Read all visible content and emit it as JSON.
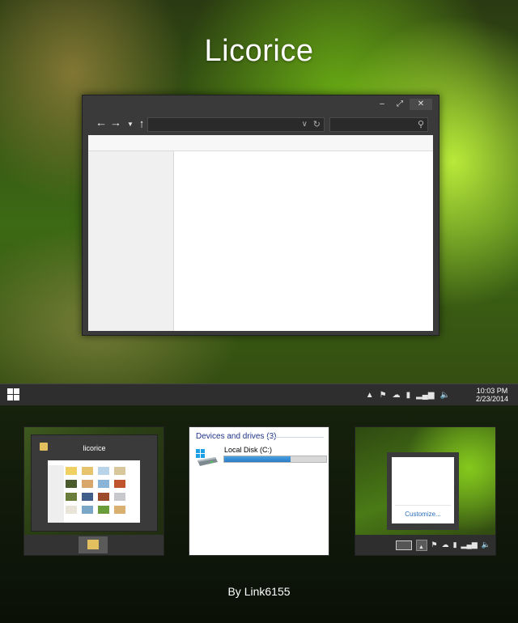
{
  "title": "Licorice",
  "credit": "By Link6155",
  "window": {
    "caption": {
      "minimize_icon": "minimize-icon",
      "maximize_icon": "maximize-icon",
      "close_icon": "close-icon"
    },
    "nav": {
      "back_icon": "back-arrow-icon",
      "forward_icon": "forward-arrow-icon",
      "recent_icon": "dropdown-icon",
      "up_icon": "up-arrow-icon"
    },
    "address_value": "",
    "search_value": ""
  },
  "taskbar": {
    "start_icon": "windows-logo-icon",
    "tray_icons": [
      "chevron-up-icon",
      "flag-icon",
      "cloud-icon",
      "battery-icon",
      "signal-icon",
      "volume-icon"
    ],
    "time": "10:03 PM",
    "date": "2/23/2014"
  },
  "thumbnails": {
    "explorer": {
      "title": "licorice",
      "colors": [
        "#f0d060",
        "#e7c36e",
        "#b9d4e8",
        "#d8c79a",
        "#4a5a2a",
        "#d9a66b",
        "#8ab3d8",
        "#c0542f",
        "#6a7d3b",
        "#3f5e8a",
        "#9c4c2c",
        "#c7c9cc",
        "#e8e4d8",
        "#7ba7c7",
        "#6a9c3a",
        "#d9b070"
      ]
    },
    "devices": {
      "heading": "Devices and drives (3)",
      "drive_label": "Local Disk (C:)",
      "drive_used_fraction": 0.65
    },
    "tray_popup": {
      "customize_label": "Customize...",
      "tray_icons": [
        "keyboard-icon",
        "chevron-up-icon",
        "flag-icon",
        "cloud-icon",
        "battery-icon",
        "signal-icon",
        "volume-icon"
      ]
    }
  }
}
